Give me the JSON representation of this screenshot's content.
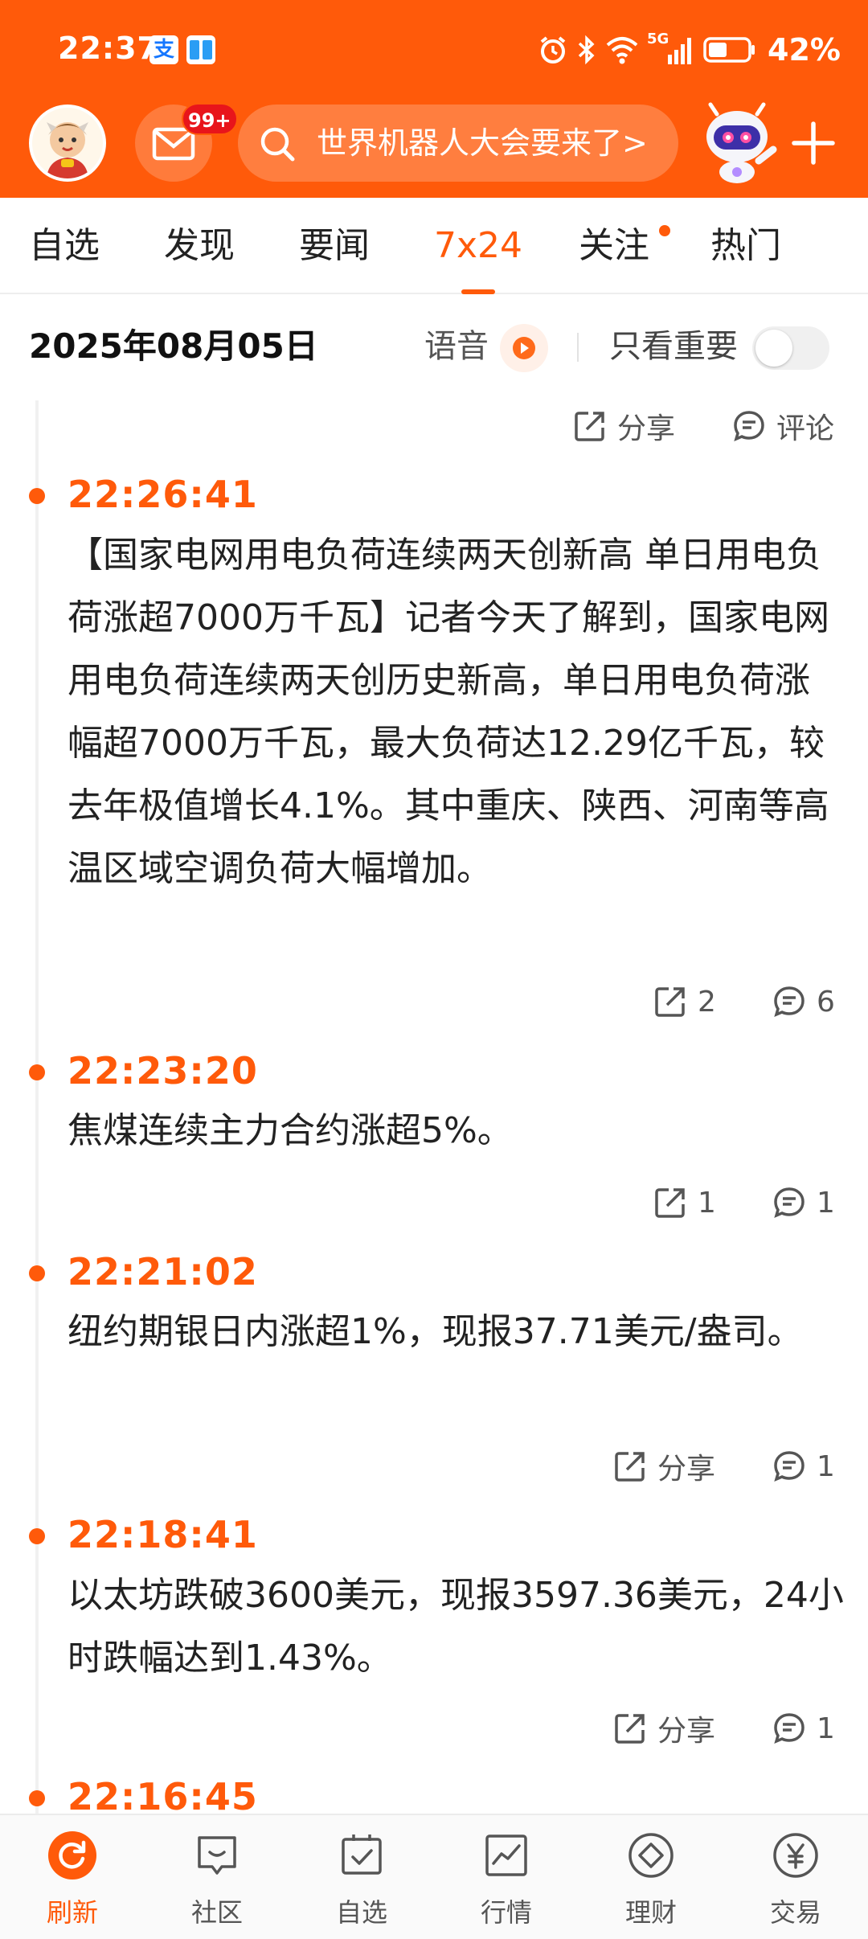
{
  "status_bar": {
    "time": "22:37",
    "alipay_glyph": "支",
    "network": "5G",
    "battery": "42%"
  },
  "header": {
    "mail_badge": "99+",
    "search_text": "世界机器人大会要来了>"
  },
  "tabs": [
    {
      "label": "自选"
    },
    {
      "label": "发现"
    },
    {
      "label": "要闻"
    },
    {
      "label": "7x24"
    },
    {
      "label": "关注"
    },
    {
      "label": "热门"
    }
  ],
  "date_bar": {
    "date": "2025年08月05日",
    "voice_label": "语音",
    "important_label": "只看重要"
  },
  "top_actions": {
    "share": "分享",
    "comment": "评论"
  },
  "news": [
    {
      "time": "22:26:41",
      "text": "【国家电网用电负荷连续两天创新高 单日用电负荷涨超7000万千瓦】记者今天了解到，国家电网用电负荷连续两天创历史新高，单日用电负荷涨幅超7000万千瓦，最大负荷达12.29亿千瓦，较去年极值增长4.1%。其中重庆、陕西、河南等高温区域空调负荷大幅增加。",
      "share": "2",
      "comments": "6"
    },
    {
      "time": "22:23:20",
      "text": "焦煤连续主力合约涨超5%。",
      "share": "1",
      "comments": "1"
    },
    {
      "time": "22:21:02",
      "text": "纽约期银日内涨超1%，现报37.71美元/盎司。",
      "share": "分享",
      "comments": "1"
    },
    {
      "time": "22:18:41",
      "text": "以太坊跌破3600美元，现报3597.36美元，24小时跌幅达到1.43%。",
      "share": "分享",
      "comments": "1"
    },
    {
      "time": "22:16:45"
    }
  ],
  "bottom_nav": [
    {
      "label": "刷新",
      "icon": "refresh-icon"
    },
    {
      "label": "社区",
      "icon": "chat-bubble-icon"
    },
    {
      "label": "自选",
      "icon": "checked-box-icon"
    },
    {
      "label": "行情",
      "icon": "line-chart-icon"
    },
    {
      "label": "理财",
      "icon": "diamond-icon"
    },
    {
      "label": "交易",
      "icon": "yen-coin-icon"
    }
  ],
  "colors": {
    "brand": "#ff5a0a",
    "badge_red": "#e8151b"
  }
}
